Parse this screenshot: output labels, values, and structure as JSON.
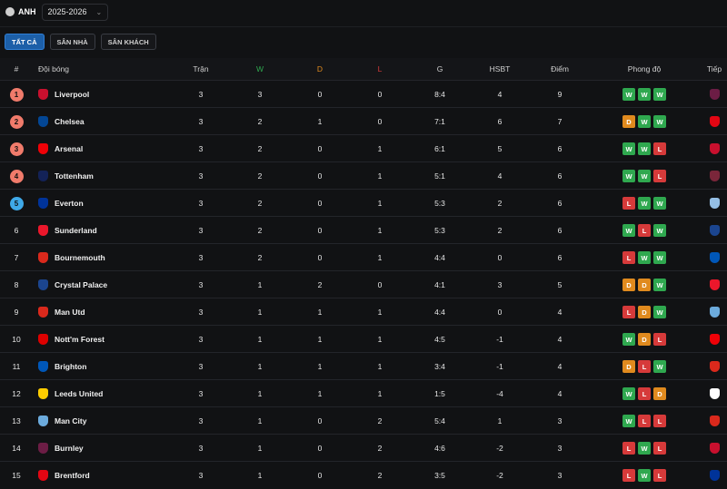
{
  "header": {
    "league_name": "ANH",
    "season": "2025-2026"
  },
  "filters": [
    "TẤT CẢ",
    "SÂN NHÀ",
    "SÂN KHÁCH"
  ],
  "active_filter": 0,
  "columns": {
    "pos": "#",
    "team": "Đội bóng",
    "played": "Trận",
    "won": "W",
    "drawn": "D",
    "lost": "L",
    "goals": "G",
    "gd": "HSBT",
    "points": "Điểm",
    "form": "Phong độ",
    "next": "Tiếp"
  },
  "colors": {
    "won": "#2fa84f",
    "drawn": "#e08a1e",
    "lost": "#d63a3a",
    "champions": "#f07b6b",
    "europa": "#3fa9e8"
  },
  "rows": [
    {
      "pos": "1",
      "pos_zone": "champions",
      "team": "Liverpool",
      "crest": "#c8102e",
      "played": "3",
      "won": "3",
      "drawn": "0",
      "lost": "0",
      "goals": "8:4",
      "gd": "4",
      "points": "9",
      "form": [
        "W",
        "W",
        "W"
      ],
      "next_crest": "#6c1d45"
    },
    {
      "pos": "2",
      "pos_zone": "champions",
      "team": "Chelsea",
      "crest": "#034694",
      "played": "3",
      "won": "2",
      "drawn": "1",
      "lost": "0",
      "goals": "7:1",
      "gd": "6",
      "points": "7",
      "form": [
        "D",
        "W",
        "W"
      ],
      "next_crest": "#e30613"
    },
    {
      "pos": "3",
      "pos_zone": "champions",
      "team": "Arsenal",
      "crest": "#ef0107",
      "played": "3",
      "won": "2",
      "drawn": "0",
      "lost": "1",
      "goals": "6:1",
      "gd": "5",
      "points": "6",
      "form": [
        "W",
        "W",
        "L"
      ],
      "next_crest": "#c8102e"
    },
    {
      "pos": "4",
      "pos_zone": "champions",
      "team": "Tottenham",
      "crest": "#132257",
      "played": "3",
      "won": "2",
      "drawn": "0",
      "lost": "1",
      "goals": "5:1",
      "gd": "4",
      "points": "6",
      "form": [
        "W",
        "W",
        "L"
      ],
      "next_crest": "#7a263a"
    },
    {
      "pos": "5",
      "pos_zone": "europa",
      "team": "Everton",
      "crest": "#003399",
      "played": "3",
      "won": "2",
      "drawn": "0",
      "lost": "1",
      "goals": "5:3",
      "gd": "2",
      "points": "6",
      "form": [
        "L",
        "W",
        "W"
      ],
      "next_crest": "#95bfe5"
    },
    {
      "pos": "6",
      "pos_zone": "none",
      "team": "Sunderland",
      "crest": "#eb172b",
      "played": "3",
      "won": "2",
      "drawn": "0",
      "lost": "1",
      "goals": "5:3",
      "gd": "2",
      "points": "6",
      "form": [
        "W",
        "L",
        "W"
      ],
      "next_crest": "#1b458f"
    },
    {
      "pos": "7",
      "pos_zone": "none",
      "team": "Bournemouth",
      "crest": "#da291c",
      "played": "3",
      "won": "2",
      "drawn": "0",
      "lost": "1",
      "goals": "4:4",
      "gd": "0",
      "points": "6",
      "form": [
        "L",
        "W",
        "W"
      ],
      "next_crest": "#0057b8"
    },
    {
      "pos": "8",
      "pos_zone": "none",
      "team": "Crystal Palace",
      "crest": "#1b458f",
      "played": "3",
      "won": "1",
      "drawn": "2",
      "lost": "0",
      "goals": "4:1",
      "gd": "3",
      "points": "5",
      "form": [
        "D",
        "D",
        "W"
      ],
      "next_crest": "#eb172b"
    },
    {
      "pos": "9",
      "pos_zone": "none",
      "team": "Man Utd",
      "crest": "#da291c",
      "played": "3",
      "won": "1",
      "drawn": "1",
      "lost": "1",
      "goals": "4:4",
      "gd": "0",
      "points": "4",
      "form": [
        "L",
        "D",
        "W"
      ],
      "next_crest": "#6cabdd"
    },
    {
      "pos": "10",
      "pos_zone": "none",
      "team": "Nott'm Forest",
      "crest": "#dd0000",
      "played": "3",
      "won": "1",
      "drawn": "1",
      "lost": "1",
      "goals": "4:5",
      "gd": "-1",
      "points": "4",
      "form": [
        "W",
        "D",
        "L"
      ],
      "next_crest": "#ef0107"
    },
    {
      "pos": "11",
      "pos_zone": "none",
      "team": "Brighton",
      "crest": "#0057b8",
      "played": "3",
      "won": "1",
      "drawn": "1",
      "lost": "1",
      "goals": "3:4",
      "gd": "-1",
      "points": "4",
      "form": [
        "D",
        "L",
        "W"
      ],
      "next_crest": "#da291c"
    },
    {
      "pos": "12",
      "pos_zone": "none",
      "team": "Leeds United",
      "crest": "#ffcd00",
      "played": "3",
      "won": "1",
      "drawn": "1",
      "lost": "1",
      "goals": "1:5",
      "gd": "-4",
      "points": "4",
      "form": [
        "W",
        "L",
        "D"
      ],
      "next_crest": "#ffffff"
    },
    {
      "pos": "13",
      "pos_zone": "none",
      "team": "Man City",
      "crest": "#6cabdd",
      "played": "3",
      "won": "1",
      "drawn": "0",
      "lost": "2",
      "goals": "5:4",
      "gd": "1",
      "points": "3",
      "form": [
        "W",
        "L",
        "L"
      ],
      "next_crest": "#da291c"
    },
    {
      "pos": "14",
      "pos_zone": "none",
      "team": "Burnley",
      "crest": "#6c1d45",
      "played": "3",
      "won": "1",
      "drawn": "0",
      "lost": "2",
      "goals": "4:6",
      "gd": "-2",
      "points": "3",
      "form": [
        "L",
        "W",
        "L"
      ],
      "next_crest": "#c8102e"
    },
    {
      "pos": "15",
      "pos_zone": "none",
      "team": "Brentford",
      "crest": "#e30613",
      "played": "3",
      "won": "1",
      "drawn": "0",
      "lost": "2",
      "goals": "3:5",
      "gd": "-2",
      "points": "3",
      "form": [
        "L",
        "W",
        "L"
      ],
      "next_crest": "#003399"
    }
  ]
}
